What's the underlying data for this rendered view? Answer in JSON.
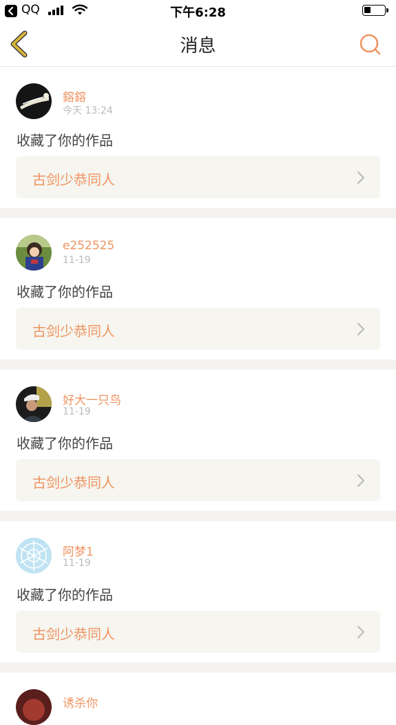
{
  "status_bar": {
    "back_app": "QQ",
    "time": "下午6:28"
  },
  "nav": {
    "title": "消息",
    "back_icon": "chevron-left-icon",
    "search_icon": "search-icon"
  },
  "colors": {
    "accent": "#ef9360",
    "nav_back": "#d8b53a",
    "card_box": "#f6f5ef",
    "separator": "#f4f3f2"
  },
  "notifications": [
    {
      "username": "鎔鎔",
      "time": "今天 13:24",
      "action": "收藏了你的作品",
      "work_title": "古剑少恭同人",
      "avatar": "avatar-dark"
    },
    {
      "username": "e252525",
      "time": "11-19",
      "action": "收藏了你的作品",
      "work_title": "古剑少恭同人",
      "avatar": "avatar-anime"
    },
    {
      "username": "好大一只鸟",
      "time": "11-19",
      "action": "收藏了你的作品",
      "work_title": "古剑少恭同人",
      "avatar": "avatar-person"
    },
    {
      "username": "阿梦1",
      "time": "11-19",
      "action": "收藏了你的作品",
      "work_title": "古剑少恭同人",
      "avatar": "avatar-snowflake"
    },
    {
      "username": "诱杀你"
    }
  ]
}
